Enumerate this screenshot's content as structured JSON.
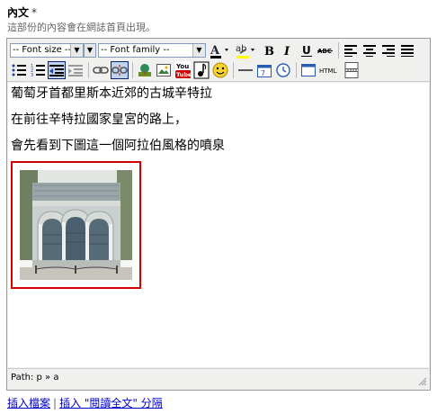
{
  "field": {
    "label": "內文",
    "required_mark": "*",
    "hint": "這部份的內容會在網誌首頁出現。"
  },
  "toolbar": {
    "font_size": "-- Font size --",
    "font_family": "-- Font family --",
    "buttons_row1": [
      {
        "name": "font-color-icon",
        "glyph": "A"
      },
      {
        "name": "highlight-color-icon",
        "glyph": "ab"
      },
      {
        "name": "bold-icon",
        "glyph": "B"
      },
      {
        "name": "italic-icon",
        "glyph": "I"
      },
      {
        "name": "underline-icon",
        "glyph": "U"
      },
      {
        "name": "strikethrough-icon",
        "glyph": "ABC"
      },
      {
        "name": "align-left-icon",
        "glyph": "≡"
      },
      {
        "name": "align-center-icon",
        "glyph": "≡"
      },
      {
        "name": "align-right-icon",
        "glyph": "≡"
      },
      {
        "name": "align-justify-icon",
        "glyph": "≡"
      }
    ],
    "youtube_label": "You Tube",
    "html_label": "HTML"
  },
  "content": {
    "paragraphs": [
      "葡萄牙首都里斯本近郊的古城辛特拉",
      "在前往辛特拉國家皇宮的路上，",
      "會先看到下圖這一個阿拉伯風格的噴泉"
    ]
  },
  "status": {
    "path": "Path: p » a"
  },
  "links": {
    "insert_file": "插入檔案",
    "separator": "|",
    "insert_more": "插入 \"閱讀全文\" 分隔"
  },
  "colors": {
    "selection_border": "#d40000",
    "link": "#0000cc"
  }
}
